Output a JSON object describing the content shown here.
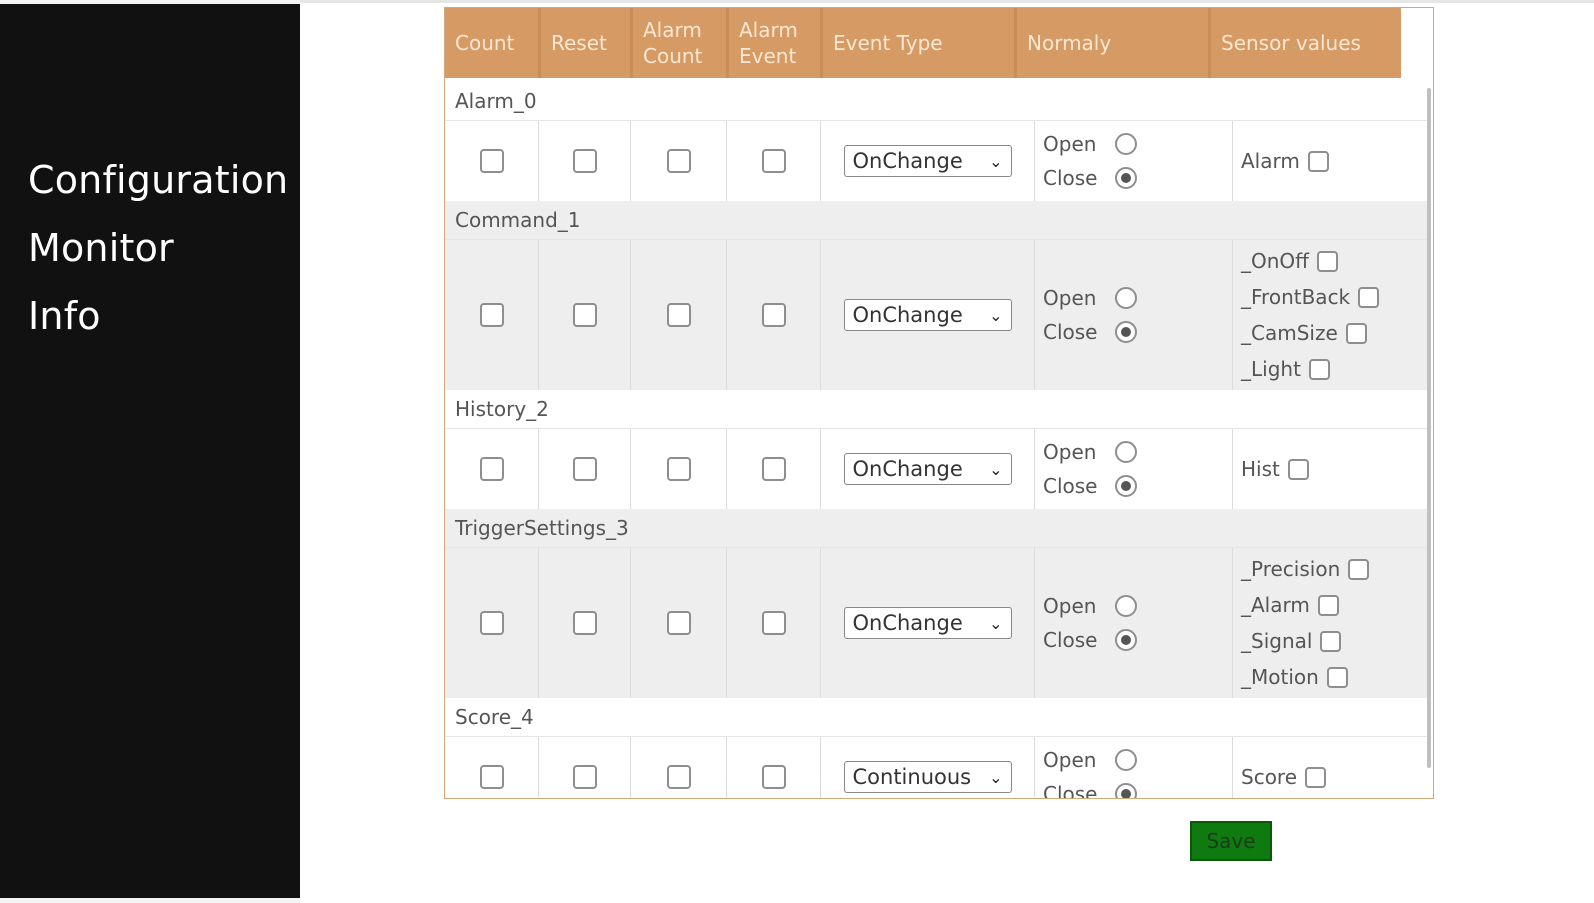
{
  "nav": {
    "items": [
      {
        "label": "Configuration"
      },
      {
        "label": "Monitor"
      },
      {
        "label": "Info"
      }
    ]
  },
  "table": {
    "headers": [
      "Count",
      "Reset",
      "Alarm\nCount",
      "Alarm\nEvent",
      "Event Type",
      "Normaly",
      "Sensor values"
    ],
    "open_label": "Open",
    "close_label": "Close",
    "groups": [
      {
        "name": "Alarm_0",
        "event_type": "OnChange",
        "normaly": "Close",
        "sensors": [
          "Alarm"
        ]
      },
      {
        "name": "Command_1",
        "event_type": "OnChange",
        "normaly": "Close",
        "sensors": [
          "_OnOff",
          "_FrontBack",
          "_CamSize",
          "_Light"
        ]
      },
      {
        "name": "History_2",
        "event_type": "OnChange",
        "normaly": "Close",
        "sensors": [
          "Hist"
        ]
      },
      {
        "name": "TriggerSettings_3",
        "event_type": "OnChange",
        "normaly": "Close",
        "sensors": [
          "_Precision",
          "_Alarm",
          "_Signal",
          "_Motion"
        ]
      },
      {
        "name": "Score_4",
        "event_type": "Continuous",
        "normaly": "Close",
        "sensors": [
          "Score"
        ]
      }
    ]
  },
  "save_label": "Save",
  "colors": {
    "header_bg": "#d69a64",
    "sidebar_bg": "#111111",
    "save_bg": "#0f7a0f"
  }
}
